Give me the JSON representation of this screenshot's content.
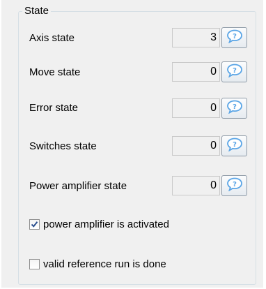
{
  "group": {
    "title": "State"
  },
  "rows": [
    {
      "label": "Axis state",
      "value": "3"
    },
    {
      "label": "Move state",
      "value": "0"
    },
    {
      "label": "Error state",
      "value": "0"
    },
    {
      "label": "Switches state",
      "value": "0"
    },
    {
      "label": "Power amplifier state",
      "value": "0"
    }
  ],
  "checkboxes": [
    {
      "label": "power amplifier is activated",
      "checked": true
    },
    {
      "label": "valid reference run is done",
      "checked": false
    }
  ],
  "icons": {
    "help": "speech-bubble-question-icon"
  },
  "colors": {
    "help_bubble": "#5aa5e6",
    "check_mark": "#2b4f8f"
  }
}
